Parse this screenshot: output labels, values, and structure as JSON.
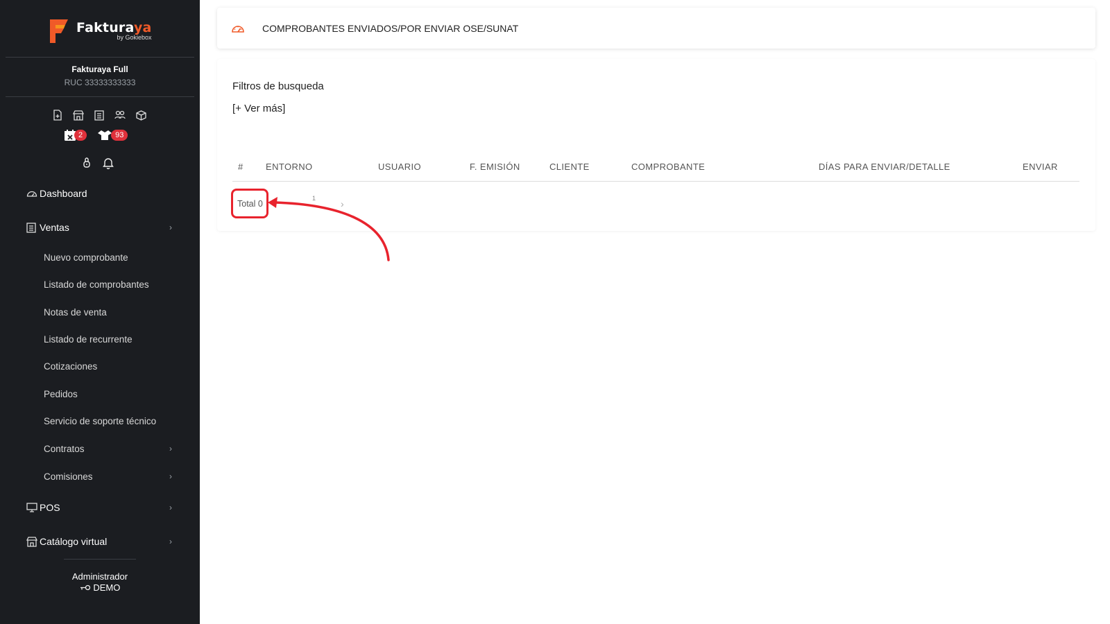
{
  "brand": {
    "name_main": "Faktura",
    "name_accent": "ya",
    "by": "by Gokiebox"
  },
  "company": {
    "name": "Fakturaya Full",
    "ruc": "RUC 33333333333"
  },
  "quick_icons": [
    "document-plus-icon",
    "store-icon",
    "receipt-icon",
    "users-icon",
    "box-icon"
  ],
  "badges": [
    {
      "icon": "calendar-x-icon",
      "count": "2"
    },
    {
      "icon": "boxes-icon",
      "count": "93"
    }
  ],
  "sidebar": {
    "dashboard": "Dashboard",
    "ventas": "Ventas",
    "ventas_items": [
      "Nuevo comprobante",
      "Listado de comprobantes",
      "Notas de venta",
      "Listado de recurrente",
      "Cotizaciones",
      "Pedidos",
      "Servicio de soporte técnico",
      "Contratos",
      "Comisiones"
    ],
    "pos": "POS",
    "catalogo": "Catálogo virtual"
  },
  "user": {
    "role": "Administrador",
    "name": "DEMO"
  },
  "header": {
    "title": "COMPROBANTES ENVIADOS/POR ENVIAR OSE/SUNAT"
  },
  "filters": {
    "title": "Filtros de busqueda",
    "more": "[+ Ver más]"
  },
  "table": {
    "columns": [
      "#",
      "ENTORNO",
      "USUARIO",
      "F. EMISIÓN",
      "CLIENTE",
      "COMPROBANTE",
      "DÍAS PARA ENVIAR/DETALLE",
      "ENVIAR"
    ]
  },
  "pagination": {
    "total": "Total 0",
    "page": "1",
    "next": "›"
  },
  "colors": {
    "sidebar_bg": "#1b1d21",
    "accent": "#f05a28",
    "badge": "#e0313b",
    "annotation": "#e8232d"
  }
}
